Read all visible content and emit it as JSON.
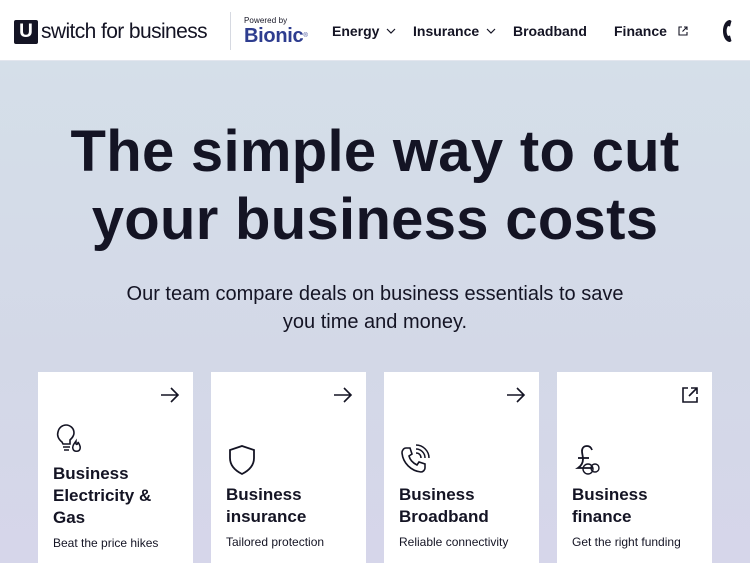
{
  "header": {
    "logo_mark": "U",
    "logo_text": "switch for business",
    "powered_by_label": "Powered by",
    "powered_by_brand": "Bionic",
    "powered_by_mark": "®",
    "nav": [
      {
        "label": "Energy",
        "has_dropdown": true,
        "icon": "chevron-down-icon"
      },
      {
        "label": "Insurance",
        "has_dropdown": true,
        "icon": "chevron-down-icon"
      },
      {
        "label": "Broadband",
        "has_dropdown": false
      },
      {
        "label": "Finance",
        "has_dropdown": false,
        "icon": "external-link-icon"
      }
    ],
    "phone_icon": "phone-icon"
  },
  "hero": {
    "title_line1": "The simple way to cut",
    "title_line2": "your business costs",
    "subtitle_line1": "Our team compare deals on business essentials to save",
    "subtitle_line2": "you time and money."
  },
  "cards": [
    {
      "title_lines": [
        "Business",
        "Electricity &",
        "Gas"
      ],
      "description": "Beat the price hikes",
      "icon": "lightbulb-flame-icon",
      "action_icon": "arrow-right-icon"
    },
    {
      "title_lines": [
        "Business",
        "insurance"
      ],
      "description": "Tailored protection",
      "icon": "shield-icon",
      "action_icon": "arrow-right-icon"
    },
    {
      "title_lines": [
        "Business",
        "Broadband"
      ],
      "description": "Reliable connectivity",
      "icon": "phone-signal-icon",
      "action_icon": "arrow-right-icon"
    },
    {
      "title_lines": [
        "Business",
        "finance"
      ],
      "description": "Get the right funding",
      "icon": "pound-coin-icon",
      "action_icon": "external-link-icon"
    }
  ],
  "colors": {
    "text_dark": "#141424",
    "bionic_blue": "#2e3d8f",
    "hero_background": "#d4dce9",
    "card_background": "#ffffff"
  }
}
